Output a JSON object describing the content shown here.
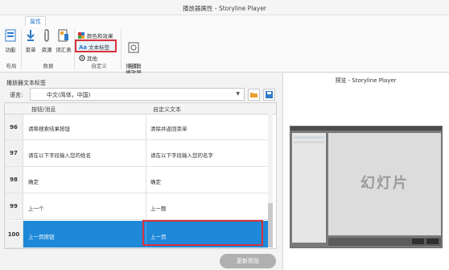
{
  "window": {
    "title": "播放器属性 - Storyline Player"
  },
  "ribbon": {
    "tab_label": "属性",
    "buttons": {
      "features": "功能",
      "menu": "菜单",
      "resources": "资源",
      "glossary": "词汇表",
      "current_player": "当前\n播放器"
    },
    "small_items": {
      "colors_effects": "颜色和效果",
      "text_labels": "文本标签",
      "other": "其他"
    },
    "groups": {
      "layout": "布局",
      "data": "数据",
      "customize": "自定义",
      "player": "播放器"
    }
  },
  "left": {
    "section_title": "播放器文本标签",
    "language_label": "语言:",
    "language_value": "中文(简体，中国)",
    "table": {
      "col1": "按钮/消息",
      "col2": "自定义文本",
      "rows": [
        {
          "num": "96",
          "message": "请降搜索结果按钮",
          "custom": "清除并返回菜单"
        },
        {
          "num": "97",
          "message": "请在以下字段输入您的姓名",
          "custom": "请在以下字段输入您的名字"
        },
        {
          "num": "98",
          "message": "确定",
          "custom": "确定"
        },
        {
          "num": "99",
          "message": "上一个",
          "custom": "上一题"
        },
        {
          "num": "100",
          "message": "上一页按钮",
          "custom": "上一页"
        }
      ]
    },
    "update_button": "更新预览"
  },
  "right": {
    "preview_title": "预览 - Storyline Player",
    "slide_text": "幻灯片"
  },
  "colors": {
    "accent": "#1e88d9",
    "highlight_border": "#d8313b",
    "tab_text": "#2d7bc9"
  }
}
